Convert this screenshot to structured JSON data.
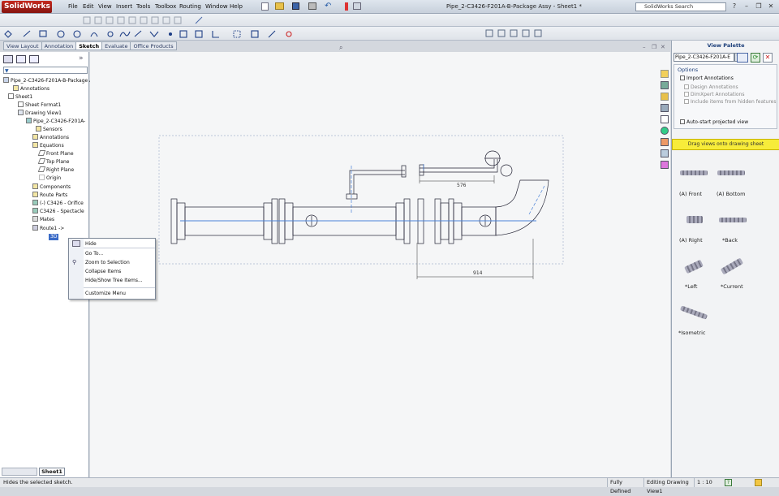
{
  "app": {
    "name": "SolidWorks",
    "doc_title": "Pipe_2-C3426-F201A-B-Package Assy - Sheet1 *"
  },
  "menu": [
    "File",
    "Edit",
    "View",
    "Insert",
    "Tools",
    "Toolbox",
    "Routing",
    "Window",
    "Help"
  ],
  "search": {
    "placeholder": "SolidWorks Search"
  },
  "tabs": [
    "View Layout",
    "Annotation",
    "Sketch",
    "Evaluate",
    "Office Products"
  ],
  "active_tab": "Sketch",
  "tree": {
    "root": "Pipe_2-C3426-F201A-B-Package A",
    "items": [
      "Annotations",
      "Sheet1",
      "Sheet Format1",
      "Drawing View1",
      "Pipe_2-C3426-F201A-",
      "Sensors",
      "Annotations",
      "Equations",
      "Front Plane",
      "Top Plane",
      "Right Plane",
      "Origin",
      "Components",
      "Route Parts",
      "(-) C3426 - Orifice",
      "C3426 - Spectacle",
      "Mates",
      "Route1 ->",
      "3D"
    ]
  },
  "context_menu": [
    "Hide",
    "Go To...",
    "Zoom to Selection",
    "Collapse Items",
    "Hide/Show Tree Items...",
    "Customize Menu"
  ],
  "drawing": {
    "dim_top": "576",
    "dim_bottom": "914"
  },
  "view_palette": {
    "title": "View Palette",
    "dropdown": "Pipe_2-C3426-F201A-E",
    "options_title": "Options",
    "options": [
      "Import Annotations",
      "Design Annotations",
      "DimXpert Annotations",
      "Include items from hidden features"
    ],
    "auto_start": "Auto-start projected view",
    "drag_hint": "Drag views onto drawing sheet",
    "views": [
      "(A) Front",
      "(A) Bottom",
      "(A) Right",
      "*Back",
      "*Left",
      "*Current",
      "*Isometric"
    ]
  },
  "sheet_tab": "Sheet1",
  "status": {
    "message": "Hides the selected sketch.",
    "defined": "Fully Defined",
    "editing": "Editing Drawing View1",
    "scale": "1 : 10"
  }
}
